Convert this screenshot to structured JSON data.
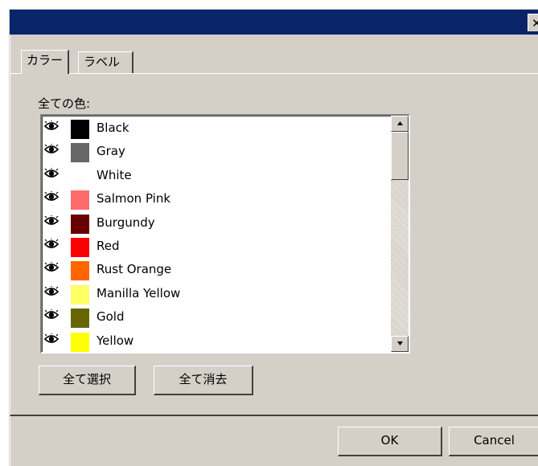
{
  "window": {
    "title": "",
    "close_glyph": "✕"
  },
  "tabs": [
    {
      "label": "カラー",
      "active": true
    },
    {
      "label": "ラベル",
      "active": false
    }
  ],
  "colors_panel": {
    "all_colors_label": "全ての色:",
    "items": [
      {
        "name": "Black",
        "color": "#000000",
        "visible": true
      },
      {
        "name": "Gray",
        "color": "#666666",
        "visible": true
      },
      {
        "name": "White",
        "color": "#ffffff",
        "visible": true
      },
      {
        "name": "Salmon Pink",
        "color": "#ff6b6b",
        "visible": true
      },
      {
        "name": "Burgundy",
        "color": "#660000",
        "visible": true
      },
      {
        "name": "Red",
        "color": "#ff0000",
        "visible": true
      },
      {
        "name": "Rust Orange",
        "color": "#ff6600",
        "visible": true
      },
      {
        "name": "Manilla Yellow",
        "color": "#ffff66",
        "visible": true
      },
      {
        "name": "Gold",
        "color": "#666600",
        "visible": true
      },
      {
        "name": "Yellow",
        "color": "#ffff00",
        "visible": true
      }
    ],
    "select_all_label": "全て選択",
    "clear_all_label": "全て消去"
  },
  "footer": {
    "ok_label": "OK",
    "cancel_label": "Cancel"
  },
  "icons": {
    "visibility": "eye-icon",
    "scroll_up": "arrow-up-icon",
    "scroll_down": "arrow-down-icon",
    "close": "close-icon"
  }
}
